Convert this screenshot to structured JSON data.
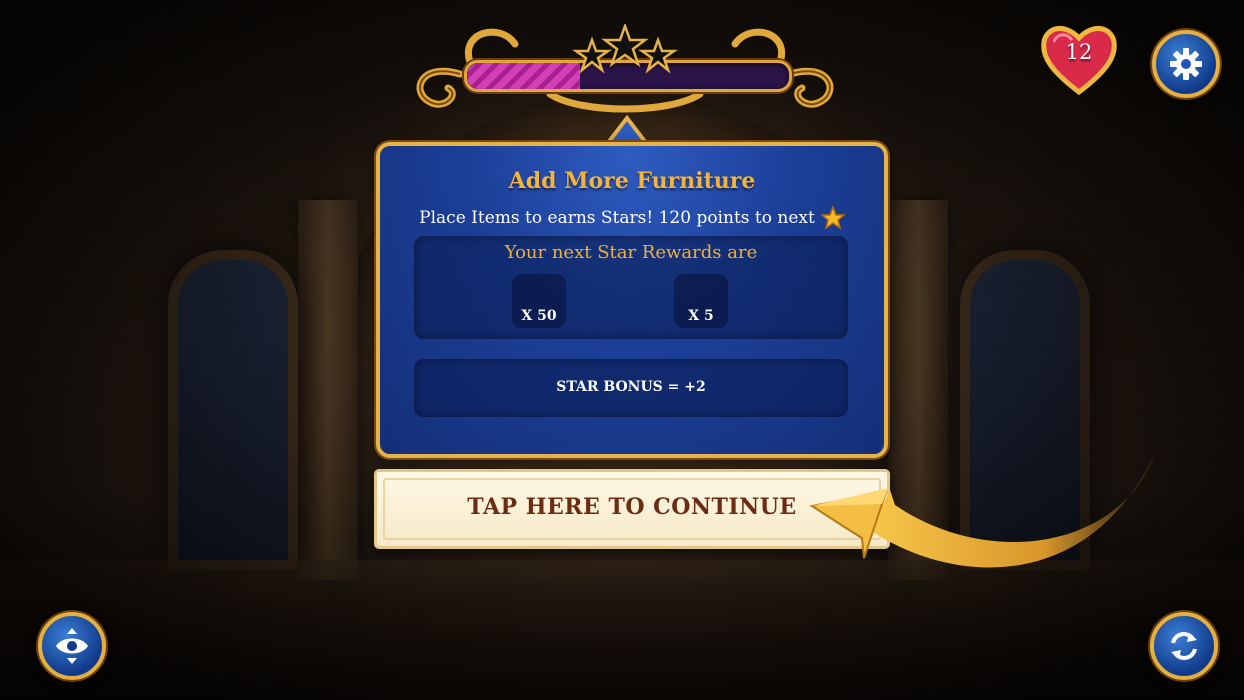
{
  "hud": {
    "lives": "12",
    "star_progress": 0.35,
    "colors": {
      "gold": "#e6b24a",
      "panel_blue": "#1c3f98",
      "progress_magenta": "#d23fb6",
      "title_gold": "#f2b43c"
    },
    "icons": {
      "lives": "heart-icon",
      "settings": "gear-icon",
      "view": "eye-icon",
      "rotate": "rotate-icon",
      "star": "star-icon"
    }
  },
  "panel": {
    "title": "Add More Furniture",
    "subtitle": "Place Items to earns Stars! 120 points to next",
    "rewards_title": "Your next Star Rewards are",
    "rewards": [
      {
        "qty": "X 50"
      },
      {
        "qty": "X 5"
      }
    ],
    "bonus": "STAR BONUS = +2"
  },
  "continue_button": {
    "label": "TAP HERE TO CONTINUE"
  }
}
